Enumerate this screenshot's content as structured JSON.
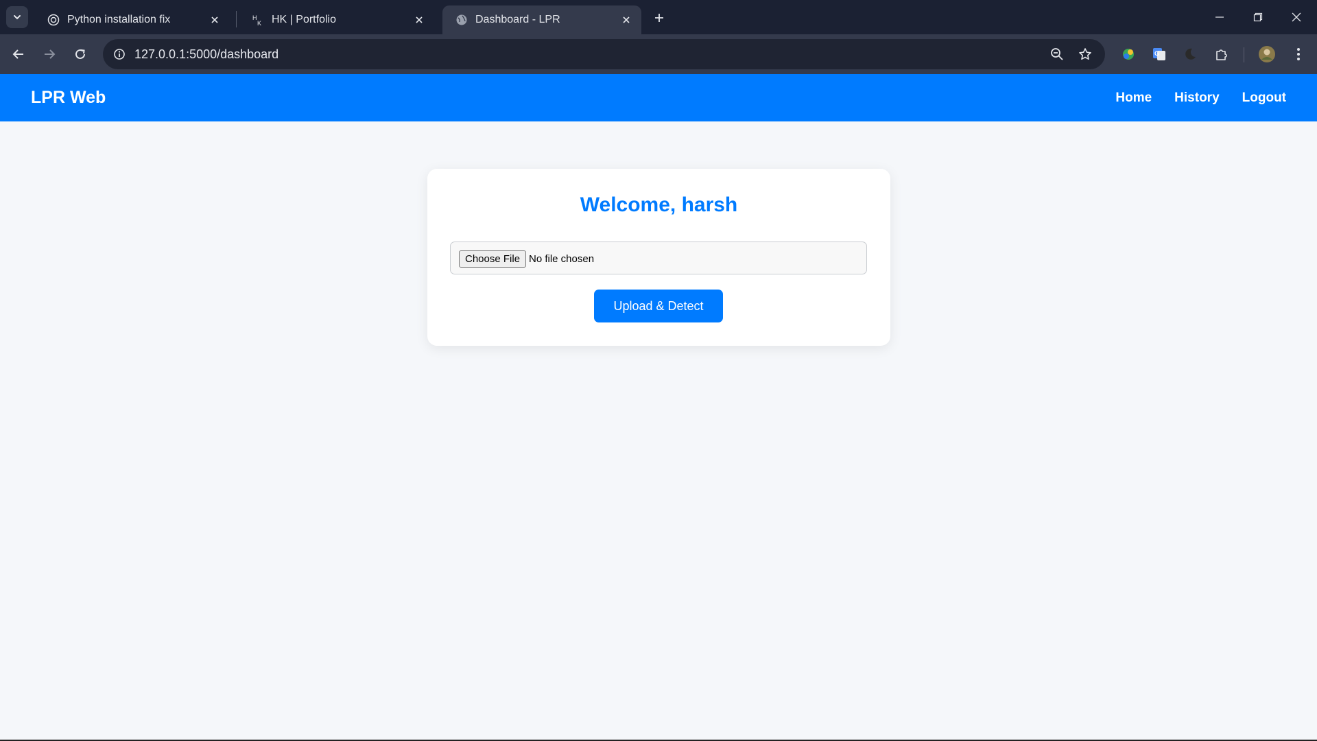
{
  "browser": {
    "tabs": [
      {
        "title": "Python installation fix",
        "favicon": "openai-icon",
        "active": false
      },
      {
        "title": "HK | Portfolio",
        "favicon": "hk-logo-icon",
        "active": false
      },
      {
        "title": "Dashboard - LPR",
        "favicon": "globe-icon",
        "active": true
      }
    ],
    "url": "127.0.0.1:5000/dashboard"
  },
  "navbar": {
    "brand": "LPR Web",
    "links": [
      "Home",
      "History",
      "Logout"
    ]
  },
  "card": {
    "title": "Welcome, harsh",
    "choose_file_label": "Choose File",
    "file_status": "No file chosen",
    "upload_label": "Upload & Detect"
  },
  "colors": {
    "primary": "#007bff",
    "page_background": "#f5f7fa",
    "browser_frame": "#1b2133",
    "browser_toolbar": "#343a4c"
  }
}
